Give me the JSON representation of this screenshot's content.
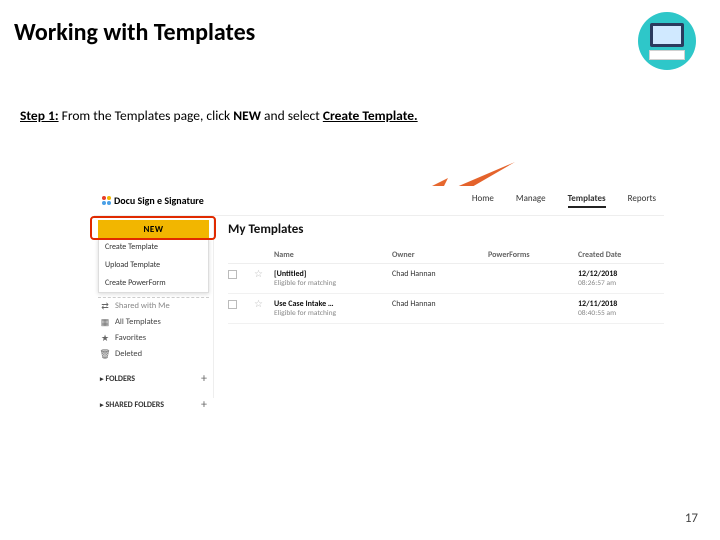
{
  "title": "Working with Templates",
  "step": {
    "label": "Step 1:",
    "text_prefix": "From the Templates page, click ",
    "text_bold1": "NEW",
    "text_mid": " and select ",
    "text_bold2": "Create Template."
  },
  "brand": "Docu Sign e Signature",
  "nav": {
    "home": "Home",
    "manage": "Manage",
    "templates": "Templates",
    "reports": "Reports"
  },
  "sidebar": {
    "new_button": "NEW",
    "menu": {
      "create_template": "Create Template",
      "upload_template": "Upload Template",
      "create_powerform": "Create PowerForm"
    },
    "items": {
      "shared_with_me": "Shared with Me",
      "all_templates": "All Templates",
      "favorites": "Favorites",
      "deleted": "Deleted"
    },
    "folders_label": "FOLDERS",
    "shared_folders_label": "SHARED FOLDERS",
    "plus": "+"
  },
  "main": {
    "title": "My Templates",
    "columns": {
      "name": "Name",
      "owner": "Owner",
      "powerforms": "PowerForms",
      "created": "Created Date"
    },
    "rows": [
      {
        "name": "[Untitled]",
        "sub": "Eligible for matching",
        "owner": "Chad Hannan",
        "date": "12/12/2018",
        "time": "08:26:57 am"
      },
      {
        "name": "Use Case Intake …",
        "sub": "Eligible for matching",
        "owner": "Chad Hannan",
        "date": "12/11/2018",
        "time": "08:40:55 am"
      }
    ]
  },
  "page_number": "17"
}
